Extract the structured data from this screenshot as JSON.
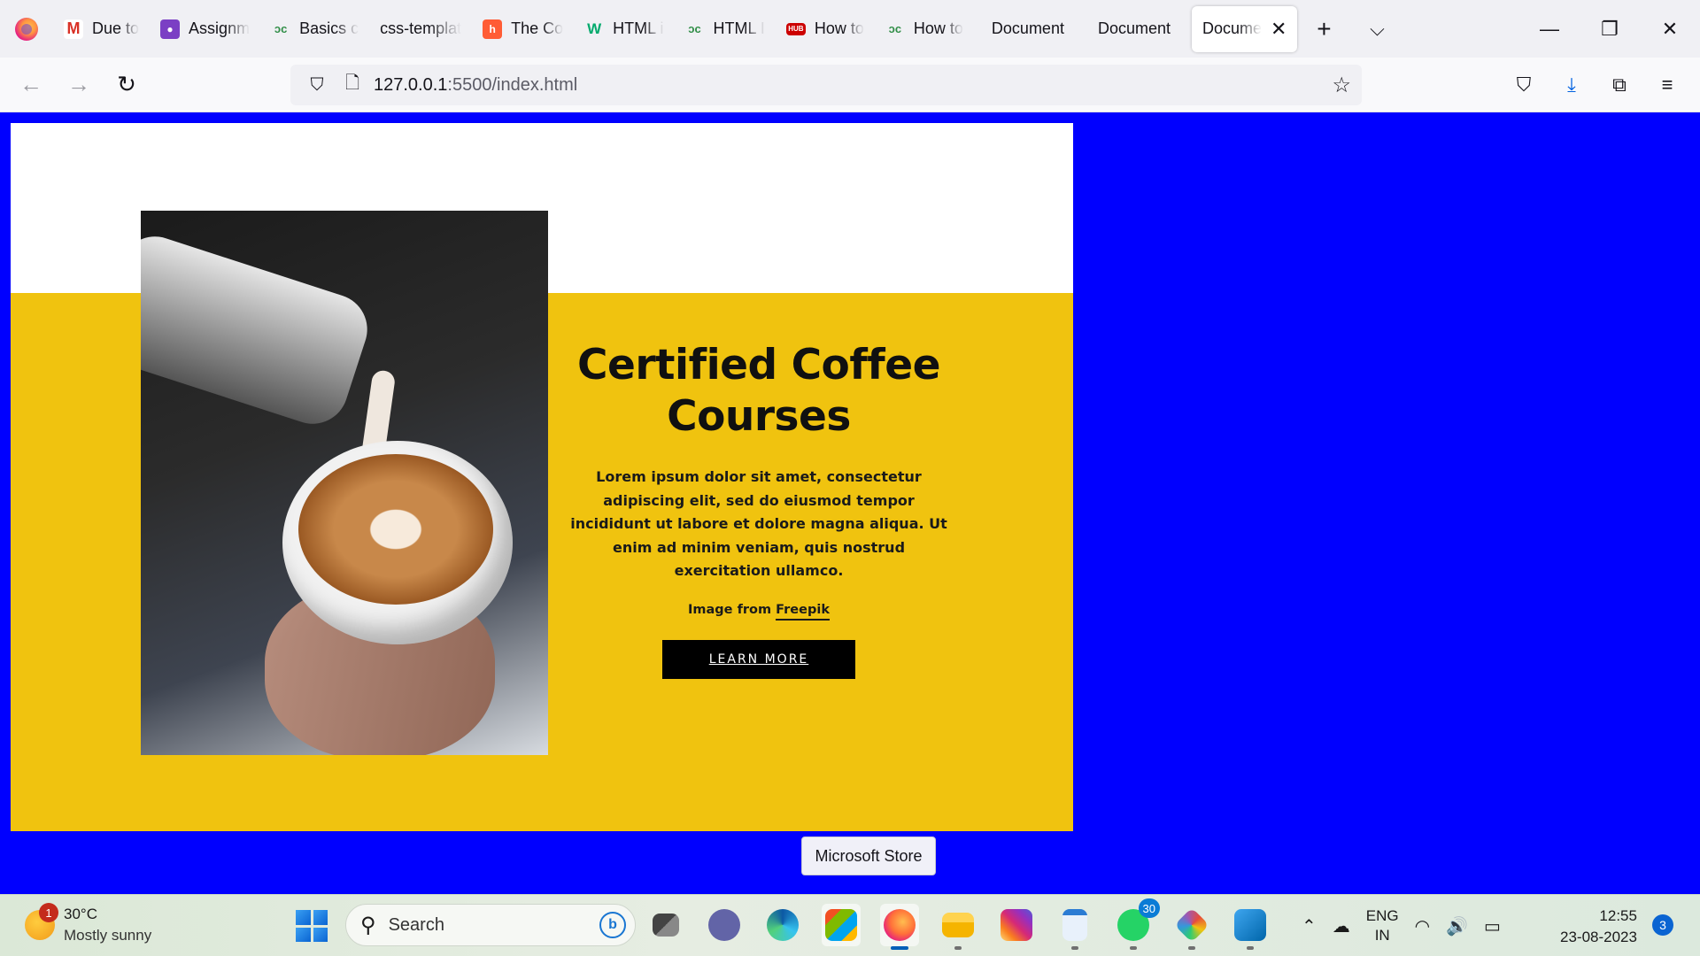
{
  "browser": {
    "tabs": [
      {
        "label": "Due to",
        "icon": "gmail-icon",
        "color": "#d93025"
      },
      {
        "label": "Assignm",
        "icon": "classroom-icon",
        "color": "#7b3fc4"
      },
      {
        "label": "Basics c",
        "icon": "gfg-icon",
        "color": "#2f8d46"
      },
      {
        "label": "css-templat",
        "icon": "",
        "color": ""
      },
      {
        "label": "The Co",
        "icon": "hubspot-icon",
        "color": "#ff5c35"
      },
      {
        "label": "HTML i",
        "icon": "w3schools-icon",
        "color": "#04aa6d"
      },
      {
        "label": "HTML I",
        "icon": "gfg-icon",
        "color": "#2f8d46"
      },
      {
        "label": "How to",
        "icon": "hub-icon",
        "color": "#cc0000"
      },
      {
        "label": "How to",
        "icon": "gfg-icon",
        "color": "#2f8d46"
      },
      {
        "label": "Document",
        "icon": "",
        "color": ""
      },
      {
        "label": "Document",
        "icon": "",
        "color": ""
      }
    ],
    "active_tab": {
      "label": "Docume"
    },
    "url_host": "127.0.0.1",
    "url_path": ":5500/index.html"
  },
  "page": {
    "background": "#0000ff",
    "accent": "#f0c30f",
    "heading": "Certified Coffee Courses",
    "description": "Lorem ipsum dolor sit amet, consectetur adipiscing elit, sed do eiusmod tempor incididunt ut labore et dolore magna aliqua. Ut enim ad minim veniam, quis nostrud exercitation ullamco.",
    "credit_prefix": "Image from",
    "credit_link": "Freepik",
    "button": "LEARN MORE",
    "tooltip": "Microsoft Store"
  },
  "taskbar": {
    "weather_temp": "30°C",
    "weather_desc": "Mostly sunny",
    "weather_badge": "1",
    "search_placeholder": "Search",
    "whatsapp_badge": "30",
    "lang_line1": "ENG",
    "lang_line2": "IN",
    "time": "12:55",
    "date": "23-08-2023",
    "notifications": "3"
  }
}
